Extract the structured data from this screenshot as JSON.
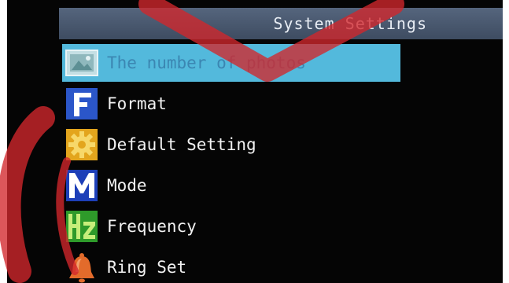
{
  "header": {
    "title": "System Settings"
  },
  "menu": {
    "items": [
      {
        "label": "The number of photos",
        "icon": "photo-icon",
        "selected": true
      },
      {
        "label": "Format",
        "icon": "format-icon"
      },
      {
        "label": "Default Setting",
        "icon": "gear-icon"
      },
      {
        "label": "Mode",
        "icon": "mode-icon"
      },
      {
        "label": "Frequency",
        "icon": "frequency-icon"
      },
      {
        "label": "Ring Set",
        "icon": "bell-icon"
      }
    ]
  },
  "colors": {
    "selection": "#53b9dc",
    "title_bar": "#4a5a72",
    "screen_background": "#050505"
  }
}
